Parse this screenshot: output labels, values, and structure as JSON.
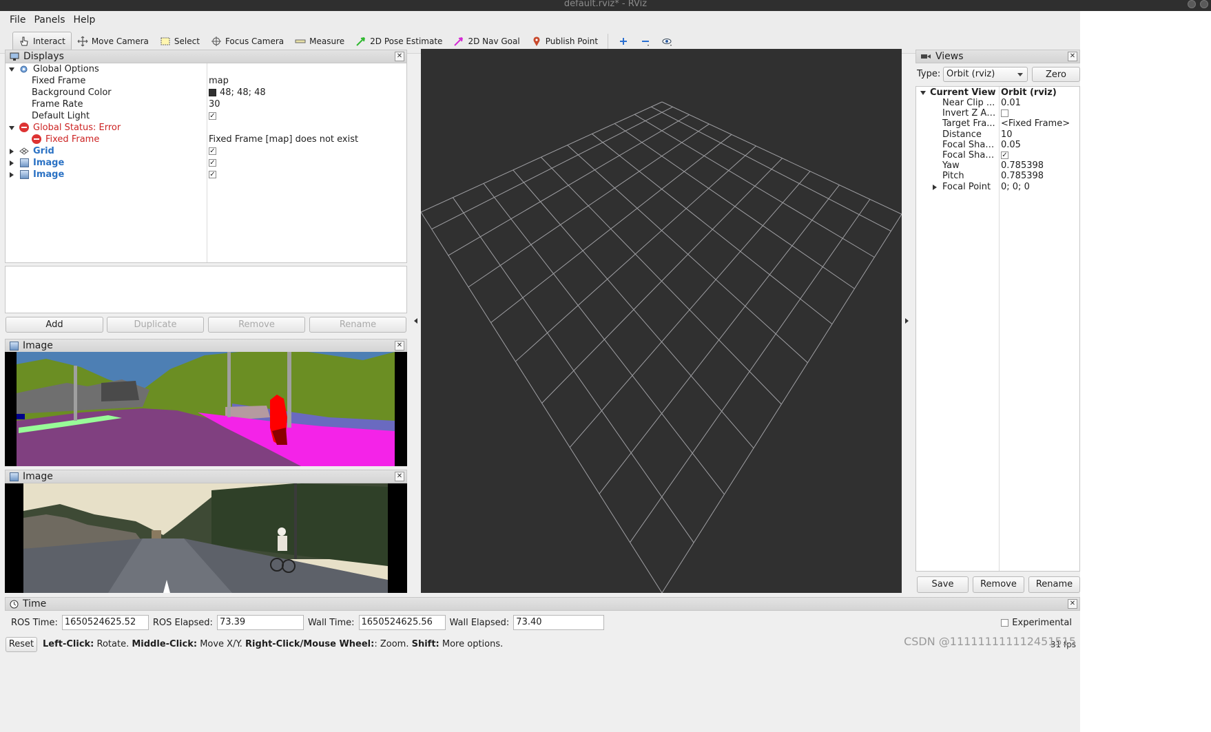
{
  "window": {
    "title": "default.rviz* - RViz"
  },
  "menu": {
    "file": "File",
    "panels": "Panels",
    "help": "Help"
  },
  "toolbar": {
    "interact": "Interact",
    "move_camera": "Move Camera",
    "select": "Select",
    "focus_camera": "Focus Camera",
    "measure": "Measure",
    "pose_estimate": "2D Pose Estimate",
    "nav_goal": "2D Nav Goal",
    "publish_point": "Publish Point"
  },
  "displays": {
    "title": "Displays",
    "global_options": "Global Options",
    "fixed_frame_label": "Fixed Frame",
    "fixed_frame_value": "map",
    "background_color_label": "Background Color",
    "background_color_value": "48; 48; 48",
    "background_color_hex": "#303030",
    "frame_rate_label": "Frame Rate",
    "frame_rate_value": "30",
    "default_light_label": "Default Light",
    "global_status_label": "Global Status: Error",
    "status_fixed_frame_label": "Fixed Frame",
    "status_fixed_frame_value": "Fixed Frame [map] does not exist",
    "grid_label": "Grid",
    "image1_label": "Image",
    "image2_label": "Image",
    "buttons": {
      "add": "Add",
      "duplicate": "Duplicate",
      "remove": "Remove",
      "rename": "Rename"
    }
  },
  "image_panels": {
    "seg_title": "Image",
    "cam_title": "Image"
  },
  "views": {
    "title": "Views",
    "type_label": "Type:",
    "type_value": "Orbit (rviz)",
    "zero": "Zero",
    "current_view_label": "Current View",
    "current_view_value": "Orbit (rviz)",
    "rows": [
      {
        "name": "Near Clip ...",
        "value": "0.01"
      },
      {
        "name": "Invert Z Axis",
        "value": ""
      },
      {
        "name": "Target Fra...",
        "value": "<Fixed Frame>"
      },
      {
        "name": "Distance",
        "value": "10"
      },
      {
        "name": "Focal Shap...",
        "value": "0.05"
      },
      {
        "name": "Focal Shap...",
        "value": ""
      },
      {
        "name": "Yaw",
        "value": "0.785398"
      },
      {
        "name": "Pitch",
        "value": "0.785398"
      },
      {
        "name": "Focal Point",
        "value": "0; 0; 0"
      }
    ],
    "buttons": {
      "save": "Save",
      "remove": "Remove",
      "rename": "Rename"
    }
  },
  "time": {
    "title": "Time",
    "ros_time_label": "ROS Time:",
    "ros_time_value": "1650524625.52",
    "ros_elapsed_label": "ROS Elapsed:",
    "ros_elapsed_value": "73.39",
    "wall_time_label": "Wall Time:",
    "wall_time_value": "1650524625.56",
    "wall_elapsed_label": "Wall Elapsed:",
    "wall_elapsed_value": "73.40",
    "experimental_label": "Experimental"
  },
  "status": {
    "reset": "Reset",
    "left_click_key": "Left-Click:",
    "left_click_text": "Rotate.",
    "middle_click_key": "Middle-Click:",
    "middle_click_text": "Move X/Y.",
    "right_click_key": "Right-Click/Mouse Wheel:",
    "right_click_text": ": Zoom.",
    "shift_key": "Shift:",
    "shift_text": "More options.",
    "fps": "31 fps"
  },
  "watermark": "CSDN @111111111112451515",
  "colors": {
    "error": "#cc2222",
    "link_blue": "#2b72c4",
    "view_bg": "#303030"
  }
}
